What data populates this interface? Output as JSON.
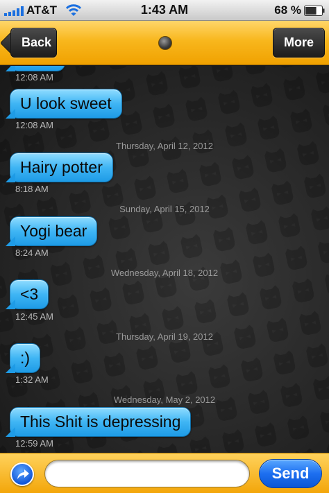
{
  "status_bar": {
    "carrier": "AT&T",
    "time": "1:43 AM",
    "battery": "68 %",
    "battery_level": 0.68,
    "signal_icon": "signal-bars-icon",
    "wifi_icon": "wifi-icon"
  },
  "nav": {
    "back_label": "Back",
    "more_label": "More",
    "status_icon": "status-dot-icon"
  },
  "messages": {
    "m0_time": "12:08 AM",
    "m1_text": "U look sweet",
    "m1_time": "12:08 AM",
    "d2": "Thursday, April 12, 2012",
    "m2_text": "Hairy potter",
    "m2_time": "8:18 AM",
    "d3": "Sunday, April 15, 2012",
    "m3_text": "Yogi bear",
    "m3_time": "8:24 AM",
    "d4": "Wednesday, April 18, 2012",
    "m4_text": "<3",
    "m4_time": "12:45 AM",
    "d5": "Thursday, April 19, 2012",
    "m5_text": ":)",
    "m5_time": "1:32 AM",
    "d6": "Wednesday, May 2, 2012",
    "m6_text": "This Shit is depressing",
    "m6_time": "12:59 AM"
  },
  "composer": {
    "input_value": "",
    "input_placeholder": "",
    "send_label": "Send",
    "share_icon": "share-arrow-icon"
  },
  "colors": {
    "nav_orange": "#f8b71d",
    "bubble_blue": "#3fb5f4",
    "send_blue": "#1d6ff0",
    "background": "#262626"
  }
}
